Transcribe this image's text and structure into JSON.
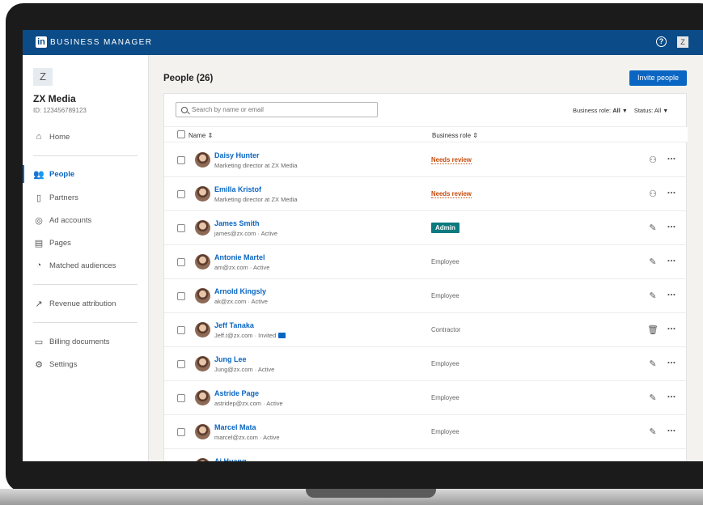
{
  "topbar": {
    "brand_logo": "in",
    "brand_text": "BUSINESS MANAGER",
    "help_icon": "?",
    "user_initial": "Z"
  },
  "sidebar": {
    "org_initial": "Z",
    "org_name": "ZX Media",
    "org_id": "ID: 123456789123",
    "items": [
      {
        "label": "Home",
        "icon": "home-icon"
      },
      {
        "label": "People",
        "icon": "people-icon"
      },
      {
        "label": "Partners",
        "icon": "building-icon"
      },
      {
        "label": "Ad accounts",
        "icon": "target-icon"
      },
      {
        "label": "Pages",
        "icon": "page-icon"
      },
      {
        "label": "Matched audiences",
        "icon": "audience-icon"
      },
      {
        "label": "Revenue attribution",
        "icon": "chart-icon"
      },
      {
        "label": "Billing documents",
        "icon": "document-icon"
      },
      {
        "label": "Settings",
        "icon": "gear-icon"
      }
    ]
  },
  "main": {
    "title": "People (26)",
    "invite_label": "Invite people",
    "search_placeholder": "Search by name or email",
    "filters": {
      "role_label": "Business role:",
      "role_value": "All",
      "status_label": "Status:",
      "status_value": "All"
    },
    "columns": {
      "name": "Name",
      "role": "Business role"
    },
    "rows": [
      {
        "name": "Daisy Hunter",
        "sub": "Marketing director at ZX Media",
        "role": "Needs review",
        "role_type": "review",
        "action": "remove-user-icon"
      },
      {
        "name": "Emilla Kristof",
        "sub": "Marketing director at ZX Media",
        "role": "Needs review",
        "role_type": "review",
        "action": "remove-user-icon"
      },
      {
        "name": "James Smith",
        "sub": "james@zx.com · Active",
        "role": "Admin",
        "role_type": "admin",
        "action": "edit-icon"
      },
      {
        "name": "Antonie Martel",
        "sub": "am@zx.com · Active",
        "role": "Employee",
        "role_type": "plain",
        "action": "edit-icon"
      },
      {
        "name": "Arnold Kingsly",
        "sub": "ak@zx.com · Active",
        "role": "Employee",
        "role_type": "plain",
        "action": "edit-icon"
      },
      {
        "name": "Jeff Tanaka",
        "sub": "Jeff.t@zx.com · Invited",
        "role": "Contractor",
        "role_type": "plain",
        "action": "trash-icon"
      },
      {
        "name": "Jung Lee",
        "sub": "Jung@zx.com · Active",
        "role": "Employee",
        "role_type": "plain",
        "action": "edit-icon"
      },
      {
        "name": "Astride Page",
        "sub": "astridep@zx.com · Active",
        "role": "Employee",
        "role_type": "plain",
        "action": "edit-icon"
      },
      {
        "name": "Marcel Mata",
        "sub": "marcel@zx.com · Active",
        "role": "Employee",
        "role_type": "plain",
        "action": "edit-icon"
      },
      {
        "name": "Ai Huang",
        "sub": "",
        "role": "",
        "role_type": "plain",
        "action": ""
      }
    ]
  },
  "colors": {
    "brand": "#0b4b87",
    "accent": "#0a66c2",
    "review": "#c54b0c",
    "admin": "#0c7a7e"
  }
}
